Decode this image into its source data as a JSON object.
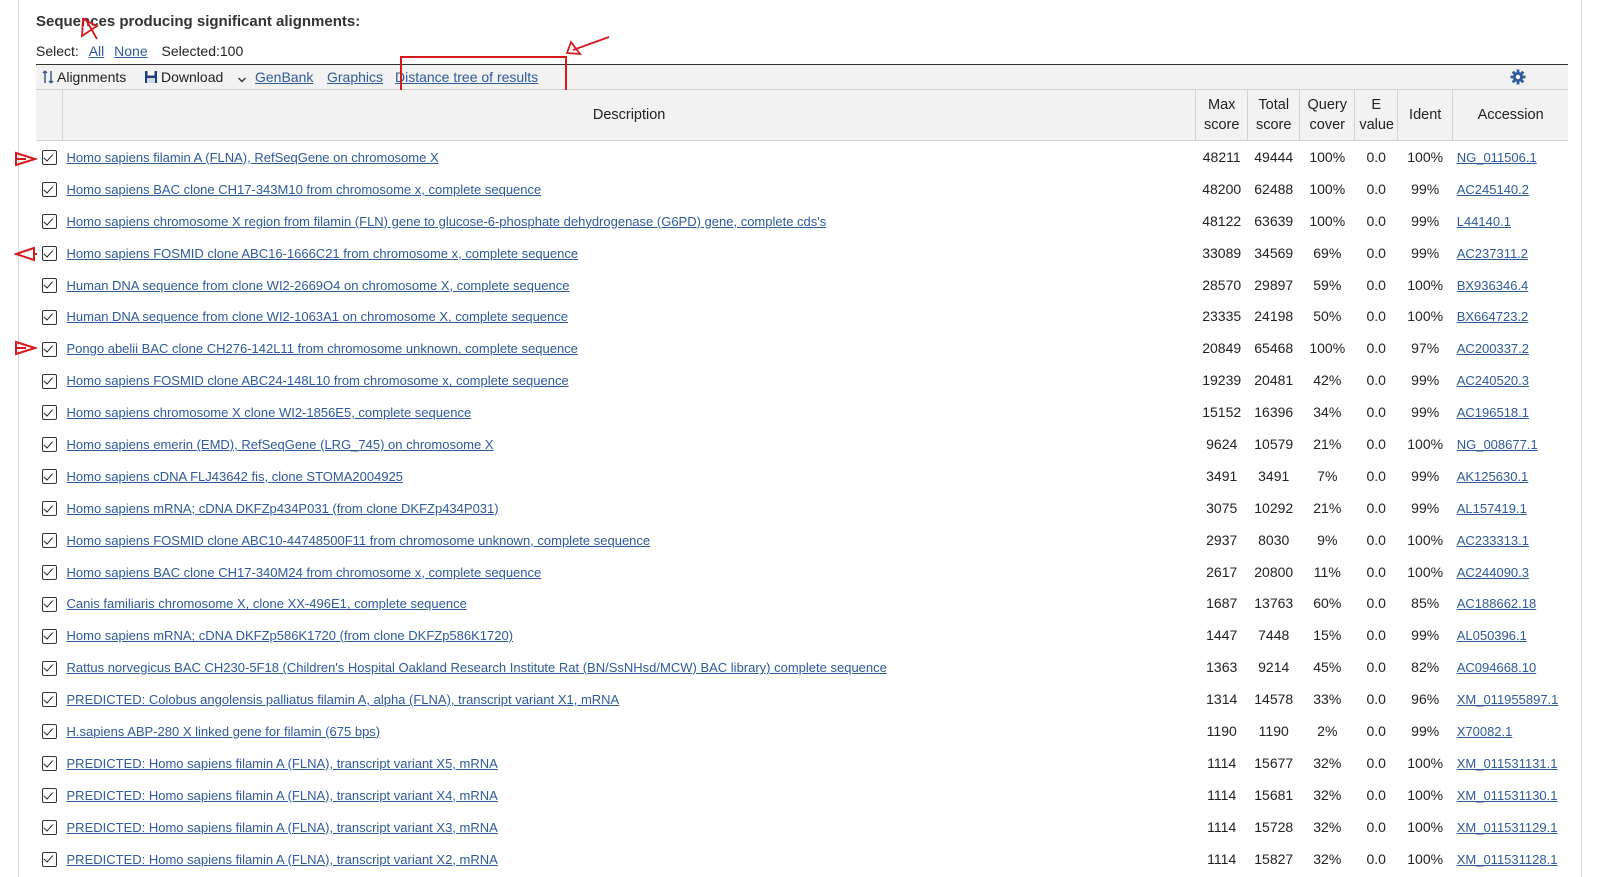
{
  "section_title": "Sequences producing significant alignments:",
  "select": {
    "label": "Select:",
    "all": "All",
    "none": "None",
    "selected": "Selected:100"
  },
  "toolbar": {
    "alignments": "Alignments",
    "download": "Download",
    "genbank": "GenBank",
    "graphics": "Graphics",
    "distance_tree": "Distance tree of results",
    "settings_icon": "gear-icon"
  },
  "table": {
    "headers": {
      "description": "Description",
      "max_score_1": "Max",
      "max_score_2": "score",
      "total_score_1": "Total",
      "total_score_2": "score",
      "query_cover_1": "Query",
      "query_cover_2": "cover",
      "e_value_1": "E",
      "e_value_2": "value",
      "ident": "Ident",
      "accession": "Accession"
    },
    "rows": [
      {
        "desc": "Homo sapiens filamin A (FLNA), RefSeqGene on chromosome X",
        "max": "48211",
        "total": "49444",
        "cover": "100%",
        "e": "0.0",
        "ident": "100%",
        "acc": "NG_011506.1"
      },
      {
        "desc": "Homo sapiens BAC clone CH17-343M10 from chromosome x, complete sequence",
        "max": "48200",
        "total": "62488",
        "cover": "100%",
        "e": "0.0",
        "ident": "99%",
        "acc": "AC245140.2"
      },
      {
        "desc": "Homo sapiens chromosome X region from filamin (FLN) gene to glucose-6-phosphate dehydrogenase (G6PD) gene, complete cds's",
        "max": "48122",
        "total": "63639",
        "cover": "100%",
        "e": "0.0",
        "ident": "99%",
        "acc": "L44140.1"
      },
      {
        "desc": "Homo sapiens FOSMID clone ABC16-1666C21 from chromosome x, complete sequence",
        "max": "33089",
        "total": "34569",
        "cover": "69%",
        "e": "0.0",
        "ident": "99%",
        "acc": "AC237311.2"
      },
      {
        "desc": "Human DNA sequence from clone WI2-2669O4 on chromosome X, complete sequence",
        "max": "28570",
        "total": "29897",
        "cover": "59%",
        "e": "0.0",
        "ident": "100%",
        "acc": "BX936346.4"
      },
      {
        "desc": "Human DNA sequence from clone WI2-1063A1 on chromosome X, complete sequence",
        "max": "23335",
        "total": "24198",
        "cover": "50%",
        "e": "0.0",
        "ident": "100%",
        "acc": "BX664723.2"
      },
      {
        "desc": "Pongo abelii BAC clone CH276-142L11 from chromosome unknown, complete sequence",
        "max": "20849",
        "total": "65468",
        "cover": "100%",
        "e": "0.0",
        "ident": "97%",
        "acc": "AC200337.2"
      },
      {
        "desc": "Homo sapiens FOSMID clone ABC24-148L10 from chromosome x, complete sequence",
        "max": "19239",
        "total": "20481",
        "cover": "42%",
        "e": "0.0",
        "ident": "99%",
        "acc": "AC240520.3"
      },
      {
        "desc": "Homo sapiens chromosome X clone WI2-1856E5, complete sequence",
        "max": "15152",
        "total": "16396",
        "cover": "34%",
        "e": "0.0",
        "ident": "99%",
        "acc": "AC196518.1"
      },
      {
        "desc": "Homo sapiens emerin (EMD), RefSeqGene (LRG_745) on chromosome X",
        "max": "9624",
        "total": "10579",
        "cover": "21%",
        "e": "0.0",
        "ident": "100%",
        "acc": "NG_008677.1"
      },
      {
        "desc": "Homo sapiens cDNA FLJ43642 fis, clone STOMA2004925",
        "max": "3491",
        "total": "3491",
        "cover": "7%",
        "e": "0.0",
        "ident": "99%",
        "acc": "AK125630.1"
      },
      {
        "desc": "Homo sapiens mRNA; cDNA DKFZp434P031 (from clone DKFZp434P031)",
        "max": "3075",
        "total": "10292",
        "cover": "21%",
        "e": "0.0",
        "ident": "99%",
        "acc": "AL157419.1"
      },
      {
        "desc": "Homo sapiens FOSMID clone ABC10-44748500F11 from chromosome unknown, complete sequence",
        "max": "2937",
        "total": "8030",
        "cover": "9%",
        "e": "0.0",
        "ident": "100%",
        "acc": "AC233313.1"
      },
      {
        "desc": "Homo sapiens BAC clone CH17-340M24 from chromosome x, complete sequence",
        "max": "2617",
        "total": "20800",
        "cover": "11%",
        "e": "0.0",
        "ident": "100%",
        "acc": "AC244090.3"
      },
      {
        "desc": "Canis familiaris chromosome X, clone XX-496E1, complete sequence",
        "max": "1687",
        "total": "13763",
        "cover": "60%",
        "e": "0.0",
        "ident": "85%",
        "acc": "AC188662.18"
      },
      {
        "desc": "Homo sapiens mRNA; cDNA DKFZp586K1720 (from clone DKFZp586K1720)",
        "max": "1447",
        "total": "7448",
        "cover": "15%",
        "e": "0.0",
        "ident": "99%",
        "acc": "AL050396.1"
      },
      {
        "desc": "Rattus norvegicus BAC CH230-5F18 (Children's Hospital Oakland Research Institute Rat (BN/SsNHsd/MCW) BAC library) complete sequence",
        "max": "1363",
        "total": "9214",
        "cover": "45%",
        "e": "0.0",
        "ident": "82%",
        "acc": "AC094668.10"
      },
      {
        "desc": "PREDICTED: Colobus angolensis palliatus filamin A, alpha (FLNA), transcript variant X1, mRNA",
        "max": "1314",
        "total": "14578",
        "cover": "33%",
        "e": "0.0",
        "ident": "96%",
        "acc": "XM_011955897.1"
      },
      {
        "desc": "H.sapiens ABP-280 X linked gene for filamin (675 bps)",
        "max": "1190",
        "total": "1190",
        "cover": "2%",
        "e": "0.0",
        "ident": "99%",
        "acc": "X70082.1"
      },
      {
        "desc": "PREDICTED: Homo sapiens filamin A (FLNA), transcript variant X5, mRNA",
        "max": "1114",
        "total": "15677",
        "cover": "32%",
        "e": "0.0",
        "ident": "100%",
        "acc": "XM_011531131.1"
      },
      {
        "desc": "PREDICTED: Homo sapiens filamin A (FLNA), transcript variant X4, mRNA",
        "max": "1114",
        "total": "15681",
        "cover": "32%",
        "e": "0.0",
        "ident": "100%",
        "acc": "XM_011531130.1"
      },
      {
        "desc": "PREDICTED: Homo sapiens filamin A (FLNA), transcript variant X3, mRNA",
        "max": "1114",
        "total": "15728",
        "cover": "32%",
        "e": "0.0",
        "ident": "100%",
        "acc": "XM_011531129.1"
      },
      {
        "desc": "PREDICTED: Homo sapiens filamin A (FLNA), transcript variant X2, mRNA",
        "max": "1114",
        "total": "15827",
        "cover": "32%",
        "e": "0.0",
        "ident": "100%",
        "acc": "XM_011531128.1"
      }
    ]
  },
  "colors": {
    "link": "#2f5b9a",
    "annotation": "#d6191d",
    "toolbar_bg": "#f2f2f2"
  }
}
